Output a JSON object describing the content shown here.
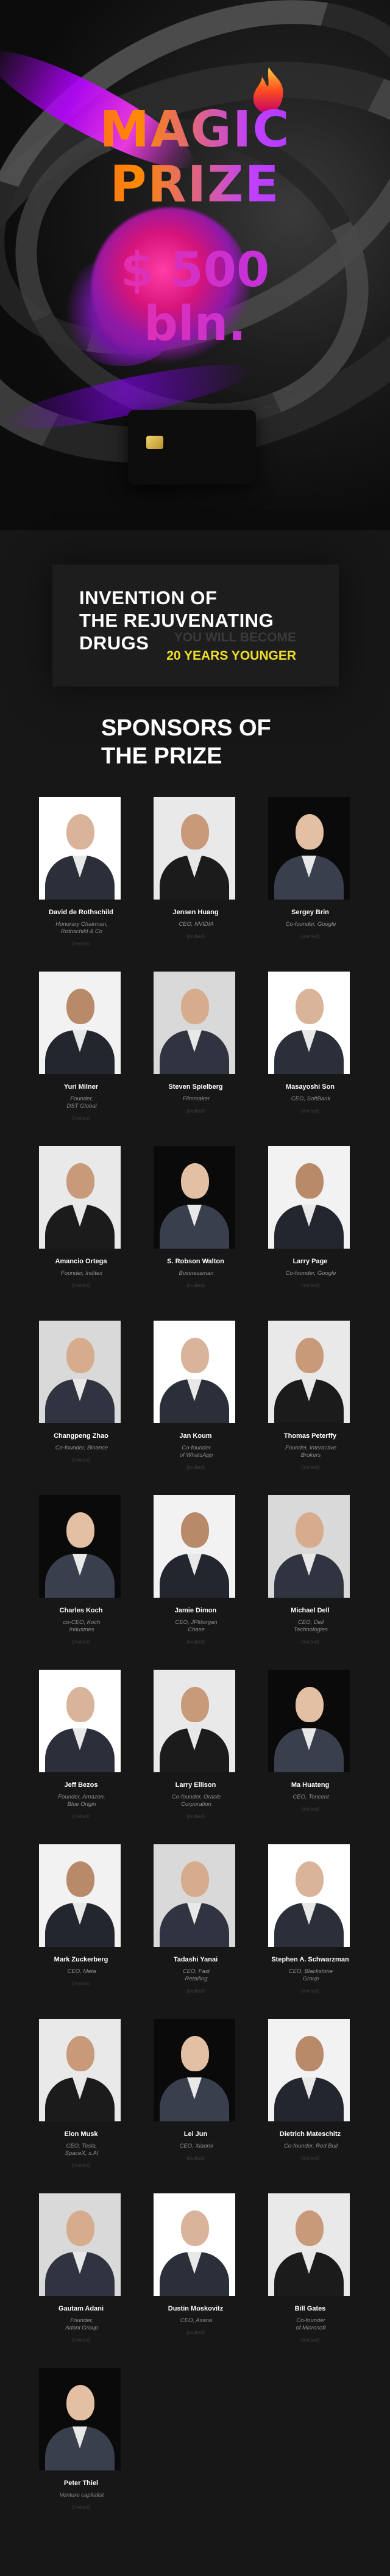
{
  "hero": {
    "line1": "MAGIC",
    "line2": "PRIZE",
    "amount1": "$ 500",
    "amount2": "bln."
  },
  "invention": {
    "title": "INVENTION OF\nTHE REJUVENATING\nDRUGS",
    "sub1": "YOU WILL BECOME",
    "sub2": "20 YEARS YOUNGER"
  },
  "sponsors_title": "SPONSORS OF\nTHE PRIZE",
  "invited_label": "(invited)",
  "colors": {
    "background": "#171717",
    "accent_yellow": "#f0e02a",
    "role_gray": "#8f8f8f"
  },
  "sponsors": [
    {
      "name": "David de Rothschild",
      "role": "Honorary Chairman,\nRothschild & Co"
    },
    {
      "name": "Jensen Huang",
      "role": "CEO, NVIDIA"
    },
    {
      "name": "Sergey Brin",
      "role": "Co-founder, Google"
    },
    {
      "name": "Yuri Milner",
      "role": "Founder,\nDST Global"
    },
    {
      "name": "Steven Spielberg",
      "role": "Filmmaker"
    },
    {
      "name": "Masayoshi Son",
      "role": "CEO, SoftBank"
    },
    {
      "name": "Amancio Ortega",
      "role": "Founder, Inditex"
    },
    {
      "name": "S. Robson Walton",
      "role": "Businessman"
    },
    {
      "name": "Larry Page",
      "role": "Co-founder, Google"
    },
    {
      "name": "Changpeng Zhao",
      "role": "Co-founder, Binance"
    },
    {
      "name": "Jan Koum",
      "role": "Co-founder\nof WhatsApp"
    },
    {
      "name": "Thomas Peterffy",
      "role": "Founder, Interactive\nBrokers"
    },
    {
      "name": "Charles Koch",
      "role": "co-CEO, Koch\nIndustries"
    },
    {
      "name": "Jamie Dimon",
      "role": "CEO, JPMorgan\nChase"
    },
    {
      "name": "Michael Dell",
      "role": "CEO, Dell\nTechnologies"
    },
    {
      "name": "Jeff Bezos",
      "role": "Founder, Amazon,\nBlue Origin"
    },
    {
      "name": "Larry Ellison",
      "role": "Co-founder, Oracle\nCorporation"
    },
    {
      "name": "Ma Huateng",
      "role": "CEO, Tencent"
    },
    {
      "name": "Mark Zuckerberg",
      "role": "CEO, Meta"
    },
    {
      "name": "Tadashi Yanai",
      "role": "CEO, Fast\nRetailing"
    },
    {
      "name": "Stephen A. Schwarzman",
      "role": "CEO, Blackstone\nGroup"
    },
    {
      "name": "Elon Musk",
      "role": "CEO, Tesla,\nSpaceX, x.AI"
    },
    {
      "name": "Lei Jun",
      "role": "CEO, Xiaomi"
    },
    {
      "name": "Dietrich Mateschitz",
      "role": "Co-founder, Red Bull"
    },
    {
      "name": "Gautam Adani",
      "role": "Founder,\nAdani Group"
    },
    {
      "name": "Dustin Moskovitz",
      "role": "CEO, Asana"
    },
    {
      "name": "Bill Gates",
      "role": "Co-founder\nof Microsoft"
    },
    {
      "name": "Peter Thiel",
      "role": "Venture capitalist"
    }
  ]
}
